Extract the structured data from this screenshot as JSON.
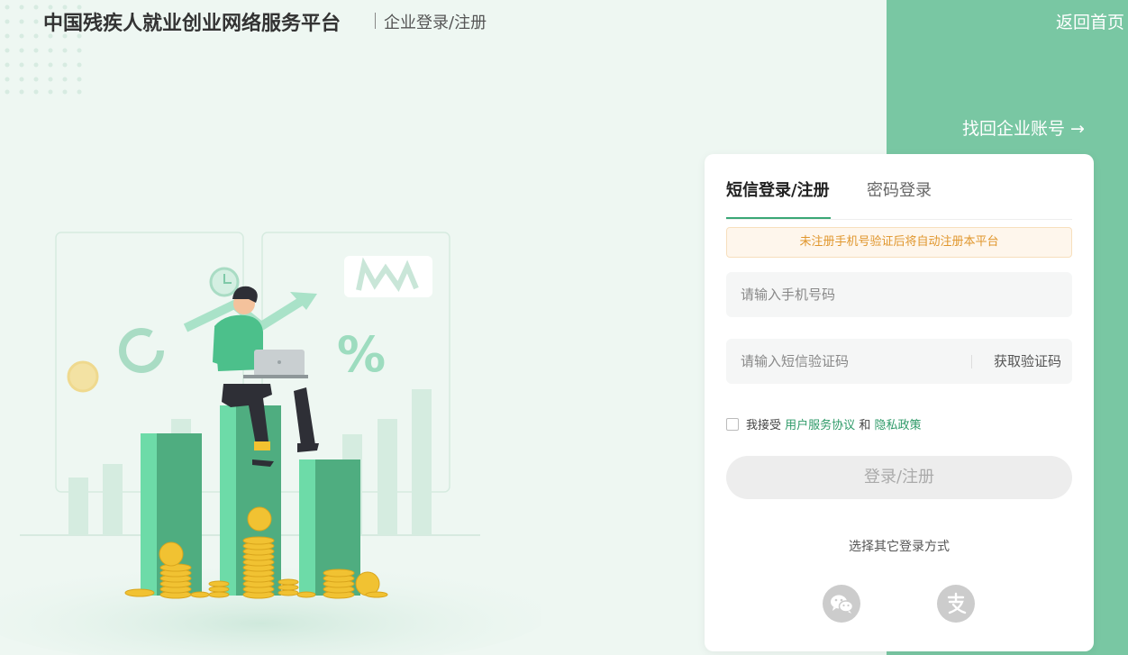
{
  "header": {
    "title": "中国残疾人就业创业网络服务平台",
    "subtitle": "企业登录/注册",
    "home_link": "返回首页",
    "recover_link": "找回企业账号 →"
  },
  "login_card": {
    "tabs": [
      {
        "label": "短信登录/注册",
        "active": true
      },
      {
        "label": "密码登录",
        "active": false
      }
    ],
    "notice": "未注册手机号验证后将自动注册本平台",
    "phone_placeholder": "请输入手机号码",
    "code_placeholder": "请输入短信验证码",
    "get_code_label": "获取验证码",
    "agreement": {
      "prefix": "我接受",
      "terms_link": "用户服务协议",
      "and": "和",
      "privacy_link": "隐私政策"
    },
    "submit_label": "登录/注册",
    "other_login_title": "选择其它登录方式",
    "other_login_icons": [
      "wechat-icon",
      "alipay-icon"
    ]
  },
  "colors": {
    "accent": "#3aa776",
    "side_band": "#79c7a3",
    "notice_text": "#e0962c"
  }
}
